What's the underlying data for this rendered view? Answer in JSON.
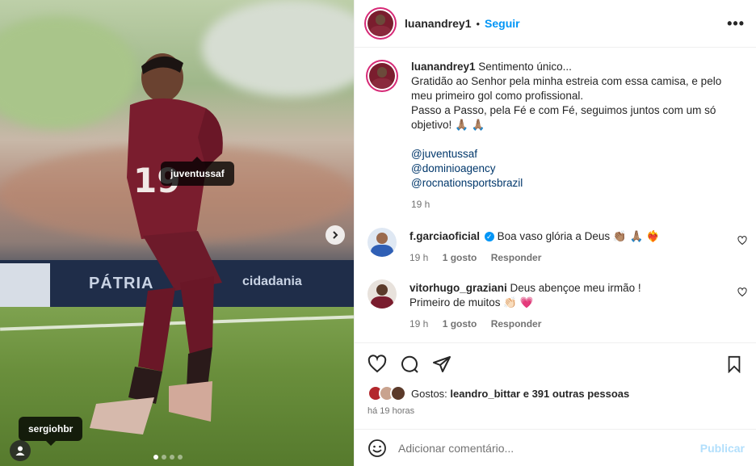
{
  "colors": {
    "accent": "#0095f6",
    "text": "#262626",
    "muted": "#737373",
    "mention": "#00376b",
    "jersey": "#7a1d2e"
  },
  "media": {
    "tags": [
      "juventussaf",
      "sergiohbr"
    ],
    "banner_text": "PÁTRIA",
    "banner_text2": "cidadania"
  },
  "header": {
    "username": "luanandrey1",
    "dot": "•",
    "follow_label": "Seguir",
    "more_icon": "more-horizontal-icon"
  },
  "caption": {
    "username": "luanandrey1",
    "lines": [
      "Sentimento único...",
      "Gratidão ao Senhor pela minha estreia com essa camisa, e pelo meu primeiro gol como profissional.",
      "Passo a Passo, pela Fé e com Fé, seguimos juntos com um só objetivo! 🙏🏽 🙏🏽"
    ],
    "mentions": [
      "@juventussaf",
      "@dominioagency",
      "@rocnationsportsbrazil"
    ],
    "time": "19 h"
  },
  "comments": [
    {
      "username": "f.garciaoficial",
      "verified": true,
      "text": "Boa vaso glória a Deus 👏🏽 🙏🏽 ❤️‍🔥",
      "time": "19 h",
      "likes": "1 gosto",
      "reply": "Responder"
    },
    {
      "username": "vitorhugo_graziani",
      "verified": false,
      "text": "Deus abençoe meu irmão ! Primeiro de muitos 👏🏻 💗",
      "time": "19 h",
      "likes": "1 gosto",
      "reply": "Responder"
    }
  ],
  "likes": {
    "prefix": "Gostos:",
    "user": "leandro_bittar",
    "rest": "e 391 outras pessoas"
  },
  "posted": "há 19 horas",
  "composer": {
    "placeholder": "Adicionar comentário...",
    "publish": "Publicar"
  }
}
